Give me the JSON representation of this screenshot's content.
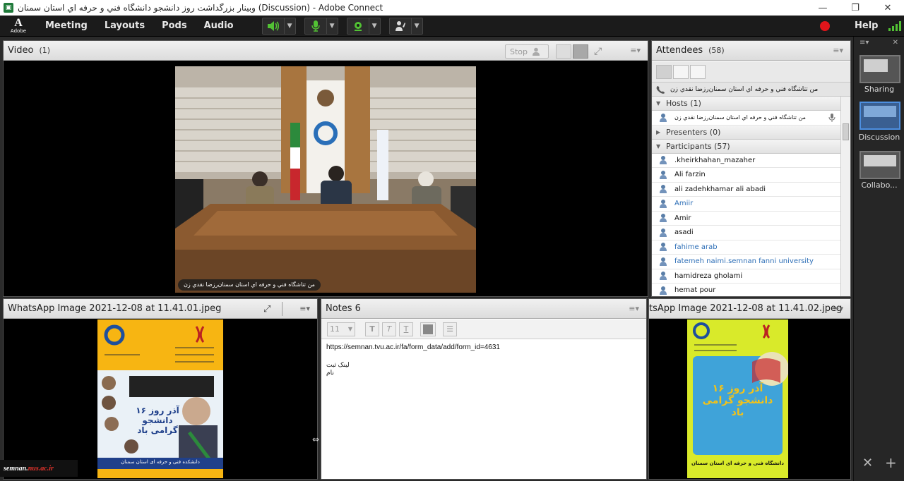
{
  "window": {
    "title": "وبينار بزرگداشت روز دانشجو دانشگاه فني و حرفه اي استان سمنان (Discussion) - Adobe Connect",
    "app_icon": "adobe-connect-icon",
    "controls": [
      "minimize-icon",
      "maximize-icon",
      "close-icon"
    ]
  },
  "menubar": {
    "logo_letter": "A",
    "logo_text": "Adobe",
    "items": [
      "Meeting",
      "Layouts",
      "Pods",
      "Audio"
    ],
    "help_label": "Help",
    "record_color": "#e0151b",
    "accent_green": "#52c234"
  },
  "video_pod": {
    "title": "Video",
    "count": "(1)",
    "stop_label": "Stop",
    "caption": "من تتاشگاه فني و حرفه اي استان سمنان‌رزضا نقدي زن"
  },
  "attendees_pod": {
    "title": "Attendees",
    "count": "(58)",
    "me_label": "من تتاشگاه فني و حرفه اي استان سمنان‌رزضا نقدي زن",
    "hosts_label": "Hosts (1)",
    "host_name": "من تتاشگاه فني و حرفه اي استان سمنان‌رزضا نقدي زن",
    "presenters_label": "Presenters (0)",
    "participants_label": "Participants (57)",
    "participants": [
      {
        "name": ".kheirkhahan_mazaher",
        "blue": false
      },
      {
        "name": "Ali farzin",
        "blue": false
      },
      {
        "name": "ali zadehkhamar ali abadi",
        "blue": false
      },
      {
        "name": "Amiir",
        "blue": true
      },
      {
        "name": "Amir",
        "blue": false
      },
      {
        "name": "asadi",
        "blue": false
      },
      {
        "name": "fahime arab",
        "blue": true
      },
      {
        "name": "fatemeh naimi.semnan fanni university",
        "blue": true
      },
      {
        "name": "hamidreza gholami",
        "blue": false
      },
      {
        "name": "hemat pour",
        "blue": false
      }
    ]
  },
  "image_pod_left": {
    "title": "WhatsApp Image 2021-12-08 at 11.41.01.jpeg",
    "poster_headline": "۱۶ آذر روز دانشجو گرامی باد",
    "poster_footer": "دانشکده فنی و حرفه ای استان سمنان"
  },
  "notes_pod": {
    "title": "Notes 6",
    "font_size": "11",
    "line1": "https://semnan.tvu.ac.ir/fa/form_data/add/form_id=4631",
    "line2": "لینک ثبت نام"
  },
  "image_pod_right": {
    "title": "tsApp Image 2021-12-08 at 11.41.02.jpeg",
    "poster_headline": "۱۶ آذر روز دانشجو گرامی باد",
    "poster_footer": "دانشگاه فنی و حرفه ای استان سمنان"
  },
  "layouts_bar": {
    "items": [
      {
        "label": "Sharing",
        "selected": false
      },
      {
        "label": "Discussion",
        "selected": true
      },
      {
        "label": "Collabo...",
        "selected": false
      }
    ]
  },
  "watermark": {
    "prefix": "semnan.",
    "domain": "nus.ac.ir"
  }
}
